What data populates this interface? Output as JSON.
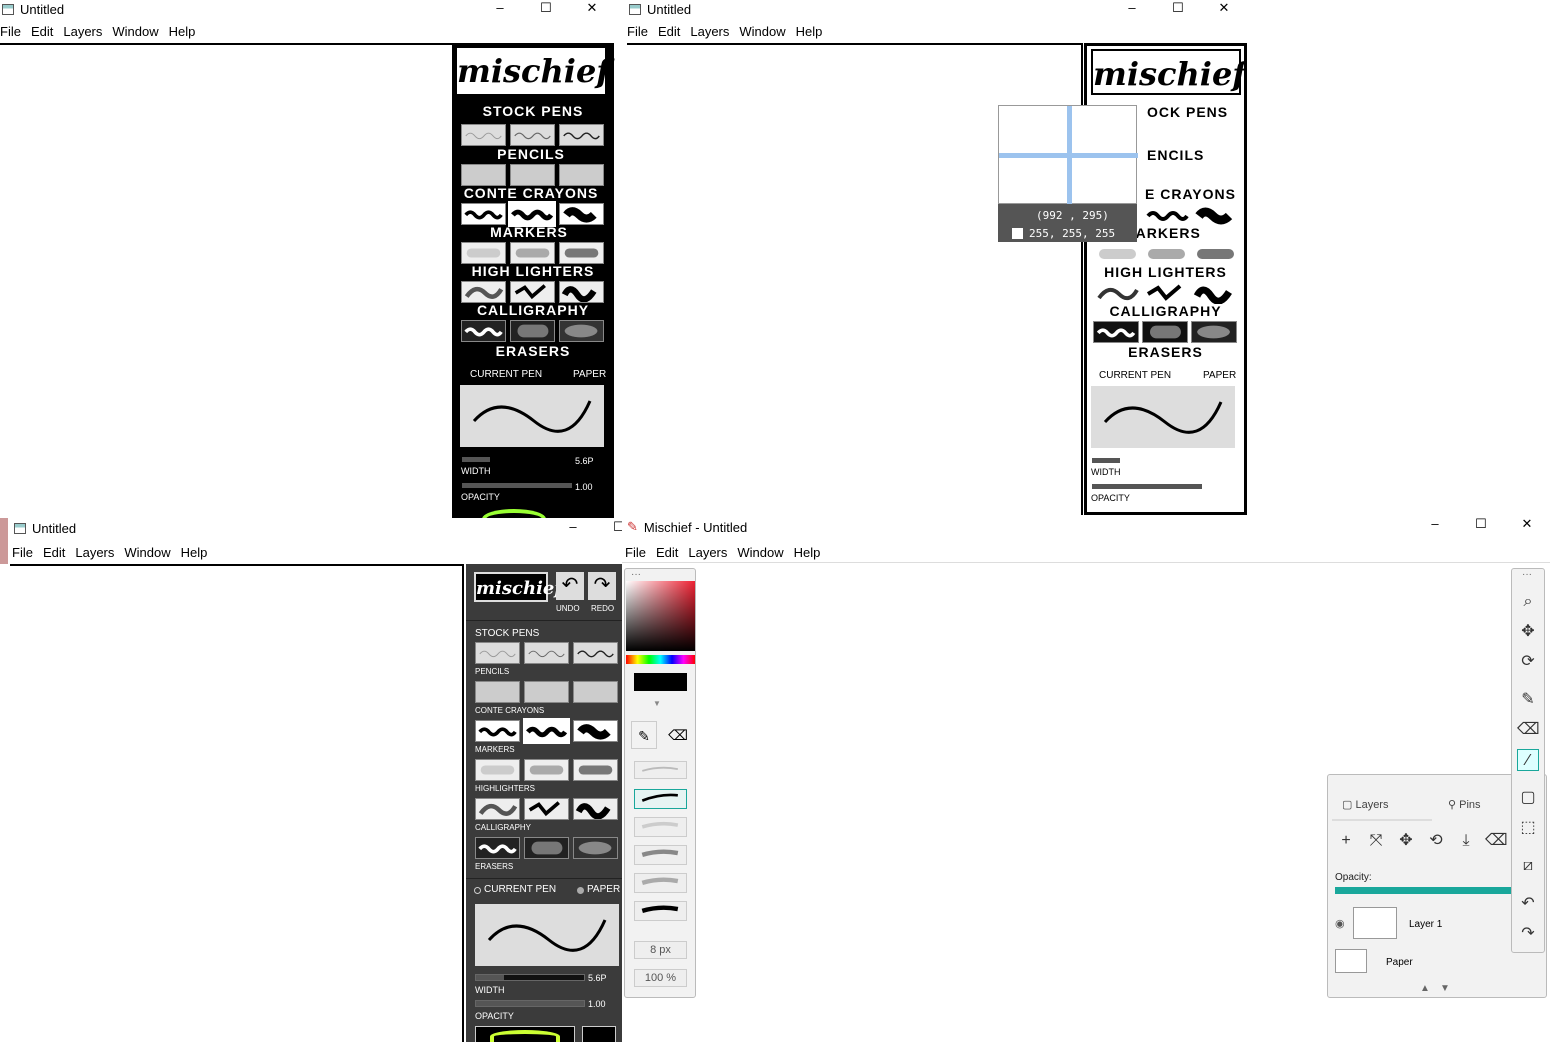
{
  "windows": {
    "tl": {
      "title": "Untitled"
    },
    "tr": {
      "title": "Untitled"
    },
    "bl": {
      "title": "Untitled"
    },
    "br": {
      "title": "Mischief - Untitled"
    }
  },
  "menu": {
    "file": "File",
    "edit": "Edit",
    "layers": "Layers",
    "window": "Window",
    "help": "Help"
  },
  "controls": {
    "minimize": "–",
    "maximize": "☐",
    "close": "✕"
  },
  "palette": {
    "logo": "mischief",
    "stock_pens": "STOCK PENS",
    "pencils": "PENCILS",
    "conte_crayons": "CONTE CRAYONS",
    "markers": "MARKERS",
    "high_lighters": "HIGH LIGHTERS",
    "highlighters": "HIGHLIGHTERS",
    "calligraphy": "CALLIGRAPHY",
    "erasers": "ERASERS",
    "current_pen": "CURRENT PEN",
    "paper": "PAPER",
    "width_value": "5.6P",
    "width_label": "WIDTH",
    "opacity_value": "1.00",
    "opacity_label": "OPACITY",
    "undo": "UNDO",
    "redo": "REDO"
  },
  "tr_partial": {
    "stock_pens": "OCK PENS",
    "pencils": "ENCILS",
    "conte_crayons": "E CRAYONS"
  },
  "color_picker_tooltip": {
    "coords": "(992 , 295)",
    "rgb": "255, 255, 255"
  },
  "modern": {
    "brush_size": "8 px",
    "brush_opacity": "100 %",
    "layers_tab": "Layers",
    "pins_tab": "Pins",
    "opacity_label": "Opacity:",
    "opacity_value": 1.0,
    "layer1": "Layer 1",
    "paper": "Paper",
    "accent": "#19a79b"
  }
}
